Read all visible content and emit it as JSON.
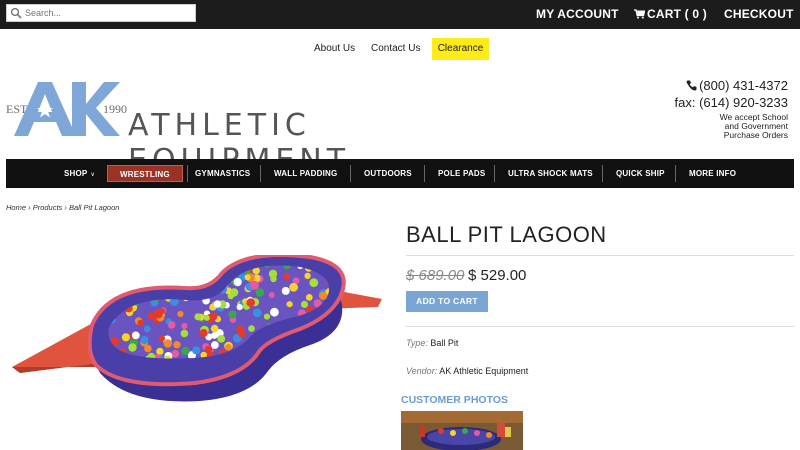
{
  "topbar": {
    "search_placeholder": "Search...",
    "account_label": "MY ACCOUNT",
    "cart_label": "CART ( 0 )",
    "checkout_label": "CHECKOUT"
  },
  "sublinks": {
    "about": "About Us",
    "contact": "Contact Us",
    "clearance": "Clearance"
  },
  "logo": {
    "est": "EST.",
    "year": "1990",
    "wordmark": "ATHLETIC EQUIPMENT",
    "letters": "AK"
  },
  "contact": {
    "phone": "(800) 431-4372",
    "fax": "fax: (614) 920-3233",
    "accept": "We accept School and Government Purchase Orders"
  },
  "nav": {
    "items": [
      {
        "label": "SHOP",
        "caret": "∨"
      },
      {
        "label": "WRESTLING"
      },
      {
        "label": "GYMNASTICS"
      },
      {
        "label": "WALL PADDING"
      },
      {
        "label": "OUTDOORS"
      },
      {
        "label": "POLE PADS"
      },
      {
        "label": "ULTRA SHOCK MATS"
      },
      {
        "label": "QUICK SHIP"
      },
      {
        "label": "MORE INFO"
      }
    ]
  },
  "breadcrumb": {
    "home": "Home",
    "sep1": " › ",
    "products": "Products",
    "sep2": " › ",
    "current": "Ball Pit Lagoon"
  },
  "product": {
    "title": "BALL PIT LAGOON",
    "old_price": "$ 689.00",
    "new_price": "$ 529.00",
    "add_to_cart": "ADD TO CART",
    "type_label": "Type:",
    "type_value": "Ball Pit",
    "vendor_label": "Vendor:",
    "vendor_value": "AK Athletic Equipment",
    "customer_photos": "CUSTOMER PHOTOS"
  },
  "colors": {
    "topbar": "#1c1c1c",
    "clearance": "#ffeb1a",
    "nav_active": "#9a3325",
    "add_cart": "#7aa6d6",
    "logo_blue": "#7ea7d8"
  }
}
